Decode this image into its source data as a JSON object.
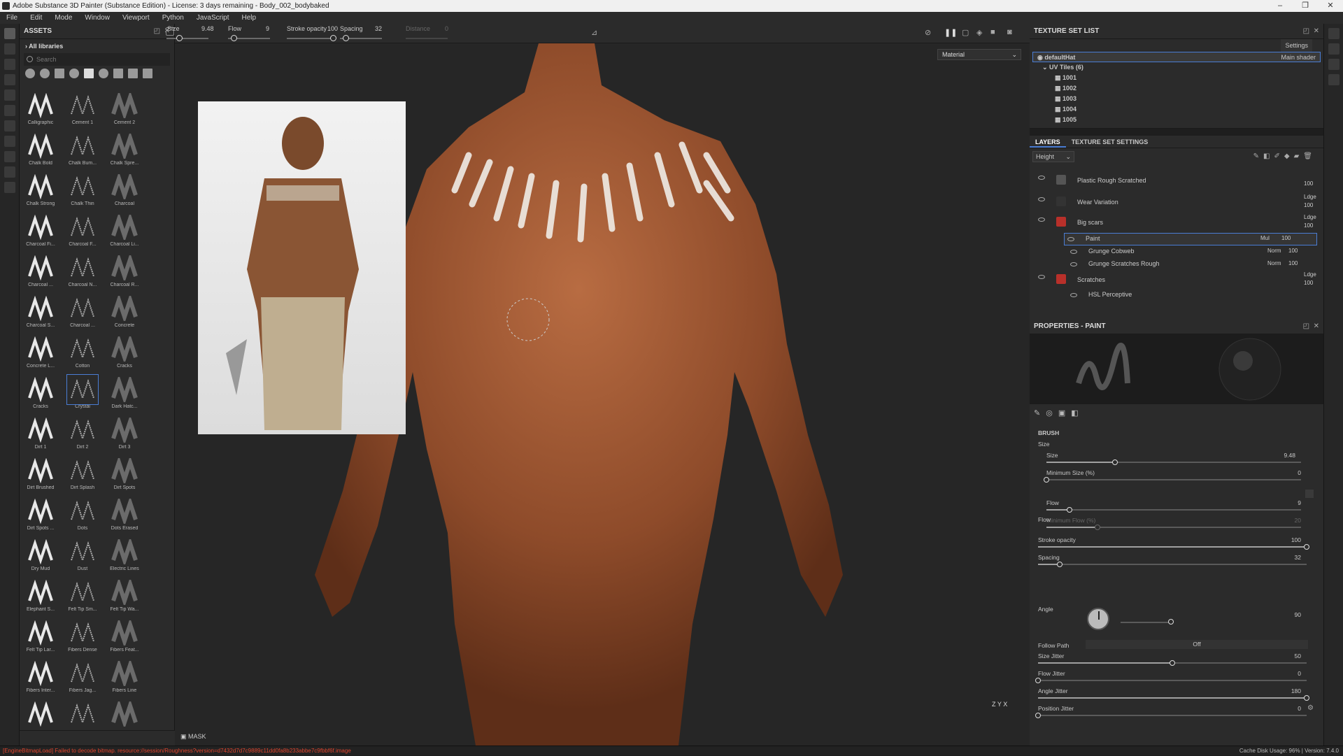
{
  "window": {
    "title": "Adobe Substance 3D Painter (Substance Edition) - License: 3 days remaining - Body_002_bodybaked",
    "controls": [
      "–",
      "❐",
      "✕"
    ]
  },
  "menu": [
    "File",
    "Edit",
    "Mode",
    "Window",
    "Viewport",
    "Python",
    "JavaScript",
    "Help"
  ],
  "assets": {
    "title": "ASSETS",
    "library": "All libraries",
    "search_placeholder": "Search",
    "brushes": [
      "Calligraphic",
      "Cement 1",
      "Cement 2",
      "Chalk Bold",
      "Chalk Bum...",
      "Chalk Spre...",
      "Chalk Strong",
      "Chalk Thin",
      "Charcoal",
      "Charcoal Fi...",
      "Charcoal F...",
      "Charcoal Li...",
      "Charcoal ...",
      "Charcoal N...",
      "Charcoal R...",
      "Charcoal S...",
      "Charcoal ...",
      "Concrete",
      "Concrete L...",
      "Cotton",
      "Cracks",
      "Cracks",
      "Crystal",
      "Dark Hatc...",
      "Dirt 1",
      "Dirt 2",
      "Dirt 3",
      "Dirt Brushed",
      "Dirt Splash",
      "Dirt Spots",
      "Dirt Spots ...",
      "Dots",
      "Dots Erased",
      "Dry Mud",
      "Dust",
      "Electric Lines",
      "Elephant S...",
      "Felt Tip Sm...",
      "Felt Tip Wa...",
      "Felt Tip Lar...",
      "Fibers Dense",
      "Fibers Feat...",
      "Fibers Inter...",
      "Fibers Jag...",
      "Fibers Line",
      "",
      "",
      ""
    ],
    "selected": "Crystal"
  },
  "toolbar": {
    "size_label": "Size",
    "size_value": "9.48",
    "flow_label": "Flow",
    "flow_value": "9",
    "opacity_label": "Stroke opacity",
    "opacity_value": "100",
    "spacing_label": "Spacing",
    "spacing_value": "32",
    "distance_label": "Distance",
    "distance_value": "0"
  },
  "viewport": {
    "material": "Material",
    "mask": "MASK",
    "axes": {
      "y": "Y",
      "z": "Z",
      "x": "X"
    }
  },
  "texture_set": {
    "title": "TEXTURE SET LIST",
    "settings": "Settings",
    "set_name": "defaultHat",
    "shader": "Main shader",
    "uv_tiles": "UV Tiles (6)",
    "tiles": [
      "1001",
      "1002",
      "1003",
      "1004",
      "1005"
    ]
  },
  "layers": {
    "tab_layers": "LAYERS",
    "tab_settings": "TEXTURE SET SETTINGS",
    "channel": "Height",
    "items": [
      {
        "name": "Plastic Rough Scratched",
        "blend": "",
        "opacity": "100"
      },
      {
        "name": "Wear Variation",
        "blend": "Ldge",
        "opacity": "100"
      },
      {
        "name": "Big scars",
        "blend": "Ldge",
        "opacity": "100"
      },
      {
        "name": "Paint",
        "blend": "Mul",
        "opacity": "100"
      },
      {
        "name": "Grunge Cobweb",
        "blend": "Norm",
        "opacity": "100"
      },
      {
        "name": "Grunge Scratches Rough",
        "blend": "Norm",
        "opacity": "100"
      },
      {
        "name": "Scratches",
        "blend": "Ldge",
        "opacity": "100"
      },
      {
        "name": "HSL Perceptive",
        "blend": "",
        "opacity": ""
      }
    ]
  },
  "properties": {
    "title": "PROPERTIES - PAINT",
    "section": "BRUSH",
    "size_group": "Size",
    "size": {
      "label": "Size",
      "value": "9.48",
      "fraction": 0.27
    },
    "min_size": {
      "label": "Minimum Size (%)",
      "value": "0",
      "fraction": 0.0
    },
    "flow_group": "Flow",
    "flow": {
      "label": "Flow",
      "value": "9",
      "fraction": 0.09
    },
    "min_flow": {
      "label": "Minimum Flow (%)",
      "value": "20",
      "fraction": 0.2
    },
    "stroke_opacity": {
      "label": "Stroke opacity",
      "value": "100",
      "fraction": 1.0
    },
    "spacing": {
      "label": "Spacing",
      "value": "32",
      "fraction": 0.08
    },
    "angle": {
      "label": "Angle",
      "value": "90",
      "fraction": 0.25
    },
    "follow_path": {
      "label": "Follow Path",
      "value": "Off"
    },
    "size_jitter": {
      "label": "Size Jitter",
      "value": "50",
      "fraction": 0.5
    },
    "flow_jitter": {
      "label": "Flow Jitter",
      "value": "0",
      "fraction": 0.0
    },
    "angle_jitter": {
      "label": "Angle Jitter",
      "value": "180",
      "fraction": 1.0
    },
    "position_jitter": {
      "label": "Position Jitter",
      "value": "0",
      "fraction": 0.0
    }
  },
  "status": {
    "error": "[EngineBitmapLoad] Failed to decode bitmap. resource://session/Roughness?version=d7432d7d7c9889c11dd0fa8b233abbe7c9fbbf6f.image",
    "right": "Cache Disk Usage:  96% | Version: 7.4.0"
  },
  "colors": {
    "accent": "#4a7dd4",
    "error": "#e0452e",
    "panel": "#2b2b2b",
    "skin": "#a05a35"
  }
}
